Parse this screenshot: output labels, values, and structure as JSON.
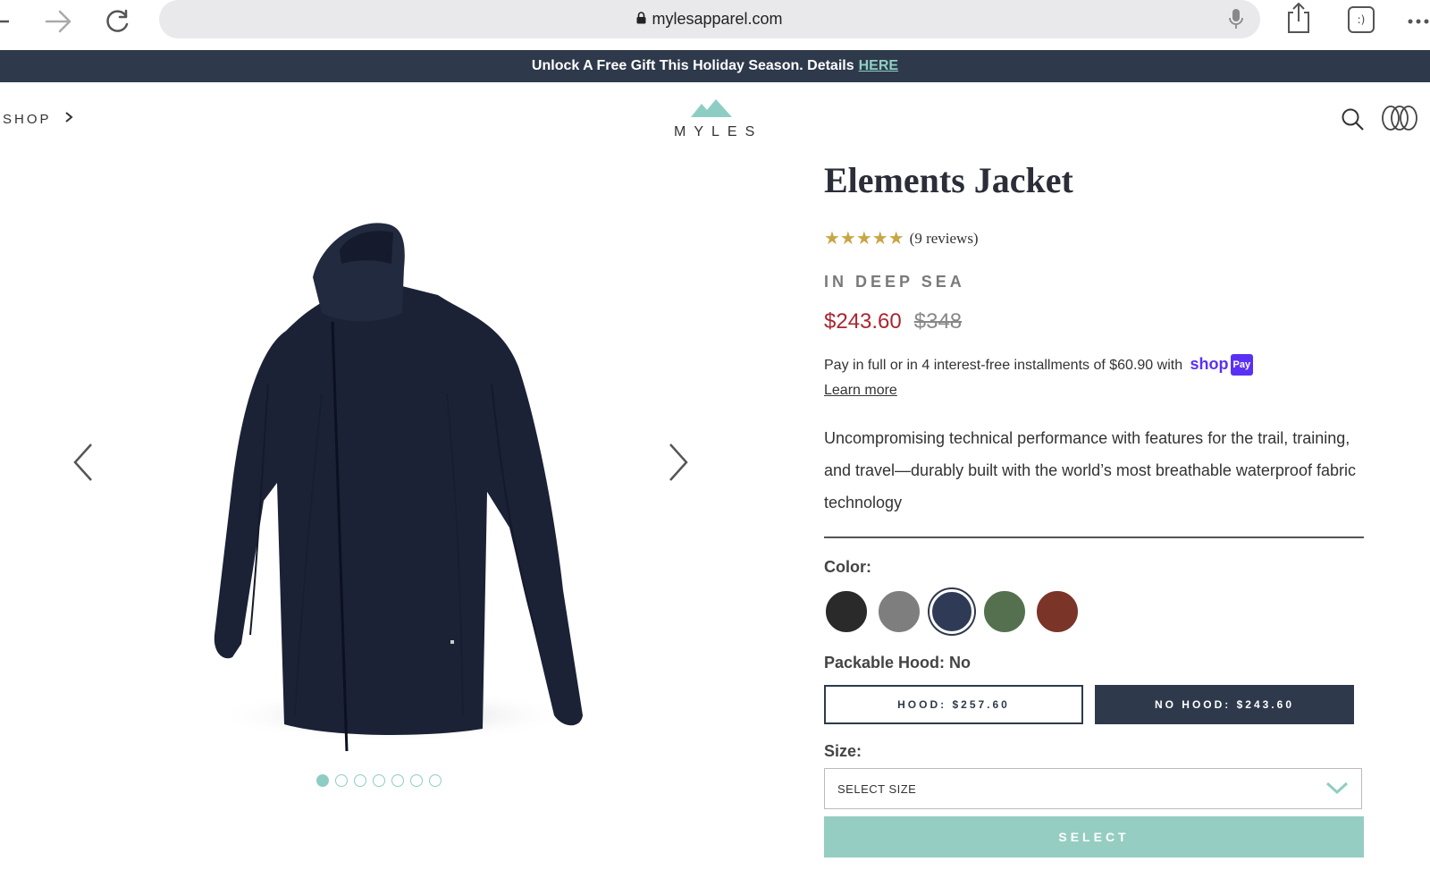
{
  "browser": {
    "url": "mylesapparel.com",
    "tabs_label": ":)"
  },
  "promo": {
    "text": "Unlock A Free Gift This Holiday Season. Details",
    "link": "HERE"
  },
  "header": {
    "shop_label": "SHOP",
    "logo_text": "MYLES"
  },
  "gallery": {
    "image_count": 7,
    "active_index": 0
  },
  "product": {
    "title": "Elements Jacket",
    "stars": "★★★★★",
    "rating_value": 5,
    "reviews": "(9 reviews)",
    "color_name": "IN DEEP SEA",
    "price_sale": "$243.60",
    "price_original": "$348",
    "installments_text": "Pay in full or in 4 interest-free installments of $60.90 with",
    "shop_pay_label": "shop",
    "pay_badge": "Pay",
    "learn_more": "Learn more",
    "description": "Uncompromising technical performance with features for the trail, training, and travel—durably built with the world’s most breathable waterproof fabric technology"
  },
  "options": {
    "color_label": "Color:",
    "swatches": [
      {
        "name": "black",
        "color": "#2a2a2a"
      },
      {
        "name": "gray",
        "color": "#7e7e7e"
      },
      {
        "name": "deep-sea",
        "color": "#2f3b56"
      },
      {
        "name": "green",
        "color": "#55704e"
      },
      {
        "name": "rust",
        "color": "#7b3428"
      }
    ],
    "selected_swatch": "deep-sea",
    "hood_label": "Packable Hood: No",
    "hood_button": "HOOD: $257.60",
    "no_hood_button": "NO HOOD: $243.60",
    "size_label": "Size:",
    "size_placeholder": "SELECT SIZE",
    "select_button": "SELECT"
  },
  "colors": {
    "accent": "#95cdc2",
    "navy": "#2e3a4b",
    "sale": "#a9262f",
    "star": "#c9a645"
  }
}
